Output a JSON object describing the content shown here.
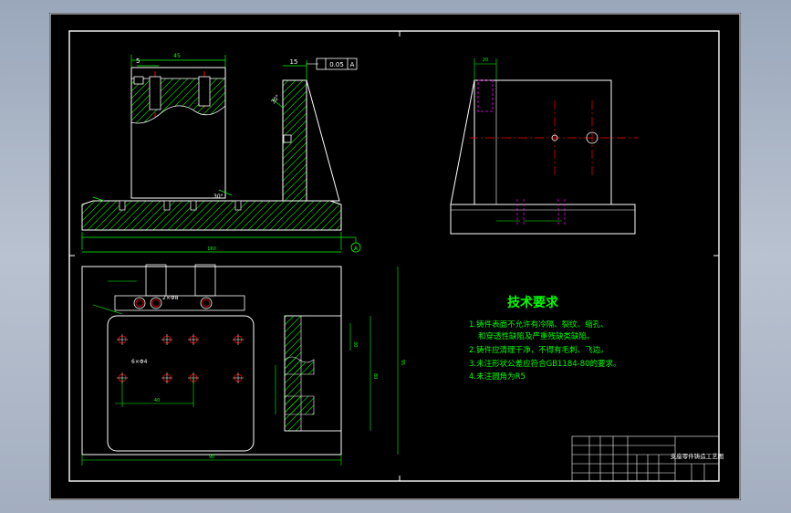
{
  "colors": {
    "background": "#000000",
    "outline": "#ffffff",
    "dimension": "#00ff00",
    "centerline": "#ff0000",
    "hidden": "#ff00ff",
    "text": "#00ff00",
    "viewport_bg": "#a9b4c5"
  },
  "dimensions": {
    "top_width": "45",
    "offset_left": "5",
    "thickness": "15",
    "flatness": "0.05",
    "datum": "A",
    "angle_a": "30°",
    "angle_b": "30°",
    "overall_length": "160",
    "hole_spec": "2×Φ8",
    "hole_spec_b": "6×Φ4",
    "plan_width": "90",
    "plan_height": "80",
    "side_height": "95",
    "side_inner": "30",
    "small_dim": "10",
    "ref_width": "20",
    "ref_a": "40",
    "ref_b": "55"
  },
  "requirements": {
    "title": "技术要求",
    "items": [
      "1.铸件表面不允许有冷隔、裂纹、缩孔、",
      "和穿透性缺陷及严重残缺类缺陷。",
      "2.铸件应清理干净，不得有毛刺、飞边。",
      "3.未注形状公差应符合GB1184-80的要求。",
      "4.未注圆角为R5"
    ]
  },
  "title_block": {
    "name": "支座零件铸造工艺图"
  }
}
